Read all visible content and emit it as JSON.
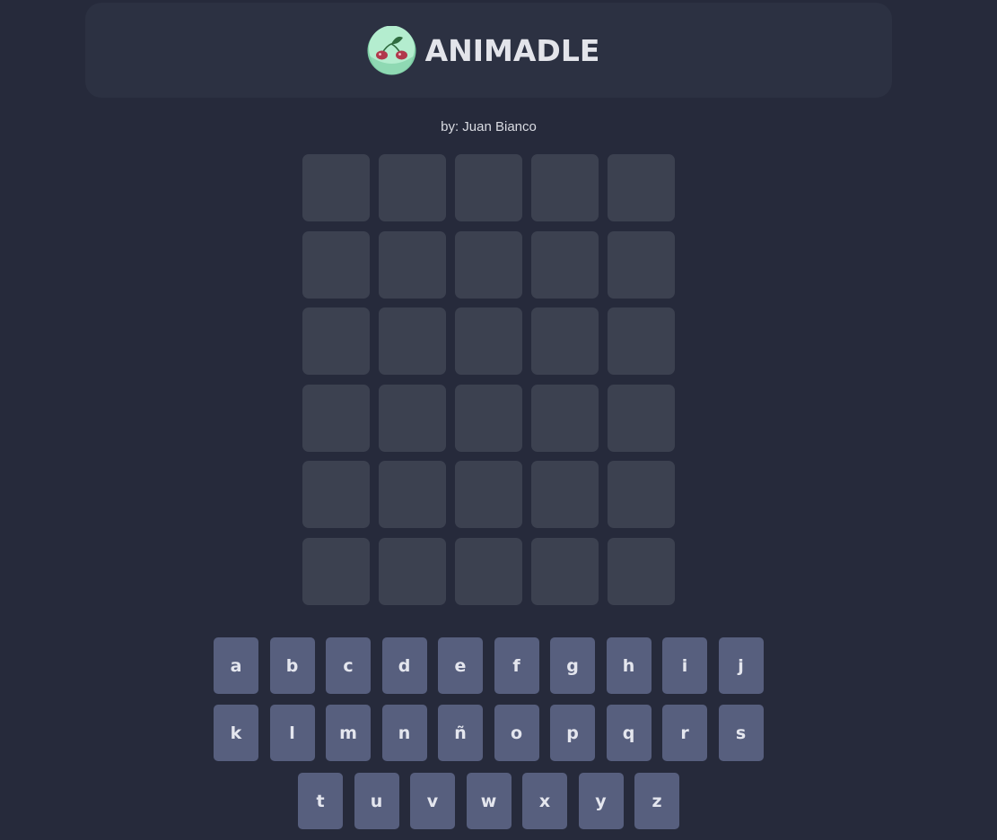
{
  "header": {
    "title": "ANIMADLE",
    "logo_icon": "cherry-logo-icon"
  },
  "byline": "by: Juan Bianco",
  "board": {
    "rows": 6,
    "cols": 5,
    "cells": [
      [
        "",
        "",
        "",
        "",
        ""
      ],
      [
        "",
        "",
        "",
        "",
        ""
      ],
      [
        "",
        "",
        "",
        "",
        ""
      ],
      [
        "",
        "",
        "",
        "",
        ""
      ],
      [
        "",
        "",
        "",
        "",
        ""
      ],
      [
        "",
        "",
        "",
        "",
        ""
      ]
    ]
  },
  "keyboard": {
    "rows": [
      [
        "a",
        "b",
        "c",
        "d",
        "e",
        "f",
        "g",
        "h",
        "i",
        "j"
      ],
      [
        "k",
        "l",
        "m",
        "n",
        "ñ",
        "o",
        "p",
        "q",
        "r",
        "s"
      ],
      [
        "t",
        "u",
        "v",
        "w",
        "x",
        "y",
        "z"
      ]
    ]
  },
  "colors": {
    "background": "#262a3b",
    "header": "#2c3142",
    "cell": "#3c4150",
    "key": "#575f7e",
    "text": "#e3e4ea",
    "logo_mint": "#a7e8c6",
    "cherry_red": "#b1384c",
    "leaf_green": "#2f6b3f"
  }
}
